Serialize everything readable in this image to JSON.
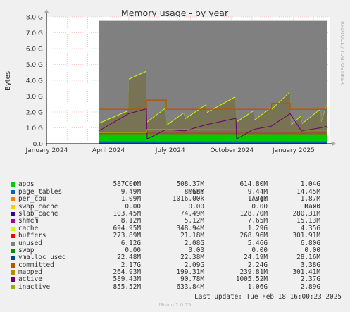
{
  "chart_data": {
    "type": "area",
    "title": "Memory usage - by year",
    "ylabel": "Bytes",
    "side_label": "RRDTOOL / TOBI OETIKER",
    "y_ticks": [
      "0.0",
      "1.0 G",
      "2.0 G",
      "3.0 G",
      "4.0 G",
      "5.0 G",
      "6.0 G",
      "7.0 G",
      "8.0 G"
    ],
    "ylim": [
      0,
      8.0
    ],
    "y_unit": "G",
    "x_ticks": [
      "January 2024",
      "April 2024",
      "July 2024",
      "October 2024",
      "January 2025"
    ],
    "grid": true,
    "legend_position": "bottom",
    "legend_headers": [
      "Cur:",
      "Min:",
      "Avg:",
      "Max:"
    ],
    "series": [
      {
        "name": "apps",
        "color": "#00cc00",
        "cur": "587.00M",
        "min": "508.37M",
        "avg": "614.80M",
        "max": "1.04G"
      },
      {
        "name": "page_tables",
        "color": "#0066b3",
        "cur": "9.49M",
        "min": "8.68M",
        "avg": "9.44M",
        "max": "14.45M"
      },
      {
        "name": "per_cpu",
        "color": "#ff8000",
        "cur": "1.09M",
        "min": "1016.00k",
        "avg": "1.31M",
        "max": "1.87M"
      },
      {
        "name": "swap_cache",
        "color": "#ffcc00",
        "cur": "0.00",
        "min": "0.00",
        "avg": "0.00",
        "max": "0.00"
      },
      {
        "name": "slab_cache",
        "color": "#330099",
        "cur": "103.45M",
        "min": "74.49M",
        "avg": "128.70M",
        "max": "280.31M"
      },
      {
        "name": "shmem",
        "color": "#990099",
        "cur": "8.12M",
        "min": "5.12M",
        "avg": "7.65M",
        "max": "15.13M"
      },
      {
        "name": "cache",
        "color": "#ccff00",
        "cur": "694.95M",
        "min": "348.94M",
        "avg": "1.29G",
        "max": "4.35G"
      },
      {
        "name": "buffers",
        "color": "#ff0000",
        "cur": "273.89M",
        "min": "21.18M",
        "avg": "268.96M",
        "max": "301.91M"
      },
      {
        "name": "unused",
        "color": "#808080",
        "cur": "6.12G",
        "min": "2.08G",
        "avg": "5.46G",
        "max": "6.80G"
      },
      {
        "name": "swap",
        "color": "#008f00",
        "cur": "0.00",
        "min": "0.00",
        "avg": "0.00",
        "max": "0.00"
      },
      {
        "name": "vmalloc_used",
        "color": "#00487d",
        "cur": "22.48M",
        "min": "22.38M",
        "avg": "24.19M",
        "max": "28.16M"
      },
      {
        "name": "committed",
        "color": "#b35a00",
        "cur": "2.17G",
        "min": "2.09G",
        "avg": "2.24G",
        "max": "3.38G"
      },
      {
        "name": "mapped",
        "color": "#b38f00",
        "cur": "264.93M",
        "min": "199.31M",
        "avg": "239.81M",
        "max": "301.41M"
      },
      {
        "name": "active",
        "color": "#6b006b",
        "cur": "589.43M",
        "min": "90.78M",
        "avg": "1005.52M",
        "max": "2.37G"
      },
      {
        "name": "inactive",
        "color": "#8fb300",
        "cur": "855.52M",
        "min": "633.84M",
        "avg": "1.06G",
        "max": "2.89G"
      }
    ]
  },
  "footer": {
    "last_update": "Last update: Tue Feb 18 16:00:23 2025",
    "munin": "Munin 2.0.75"
  }
}
